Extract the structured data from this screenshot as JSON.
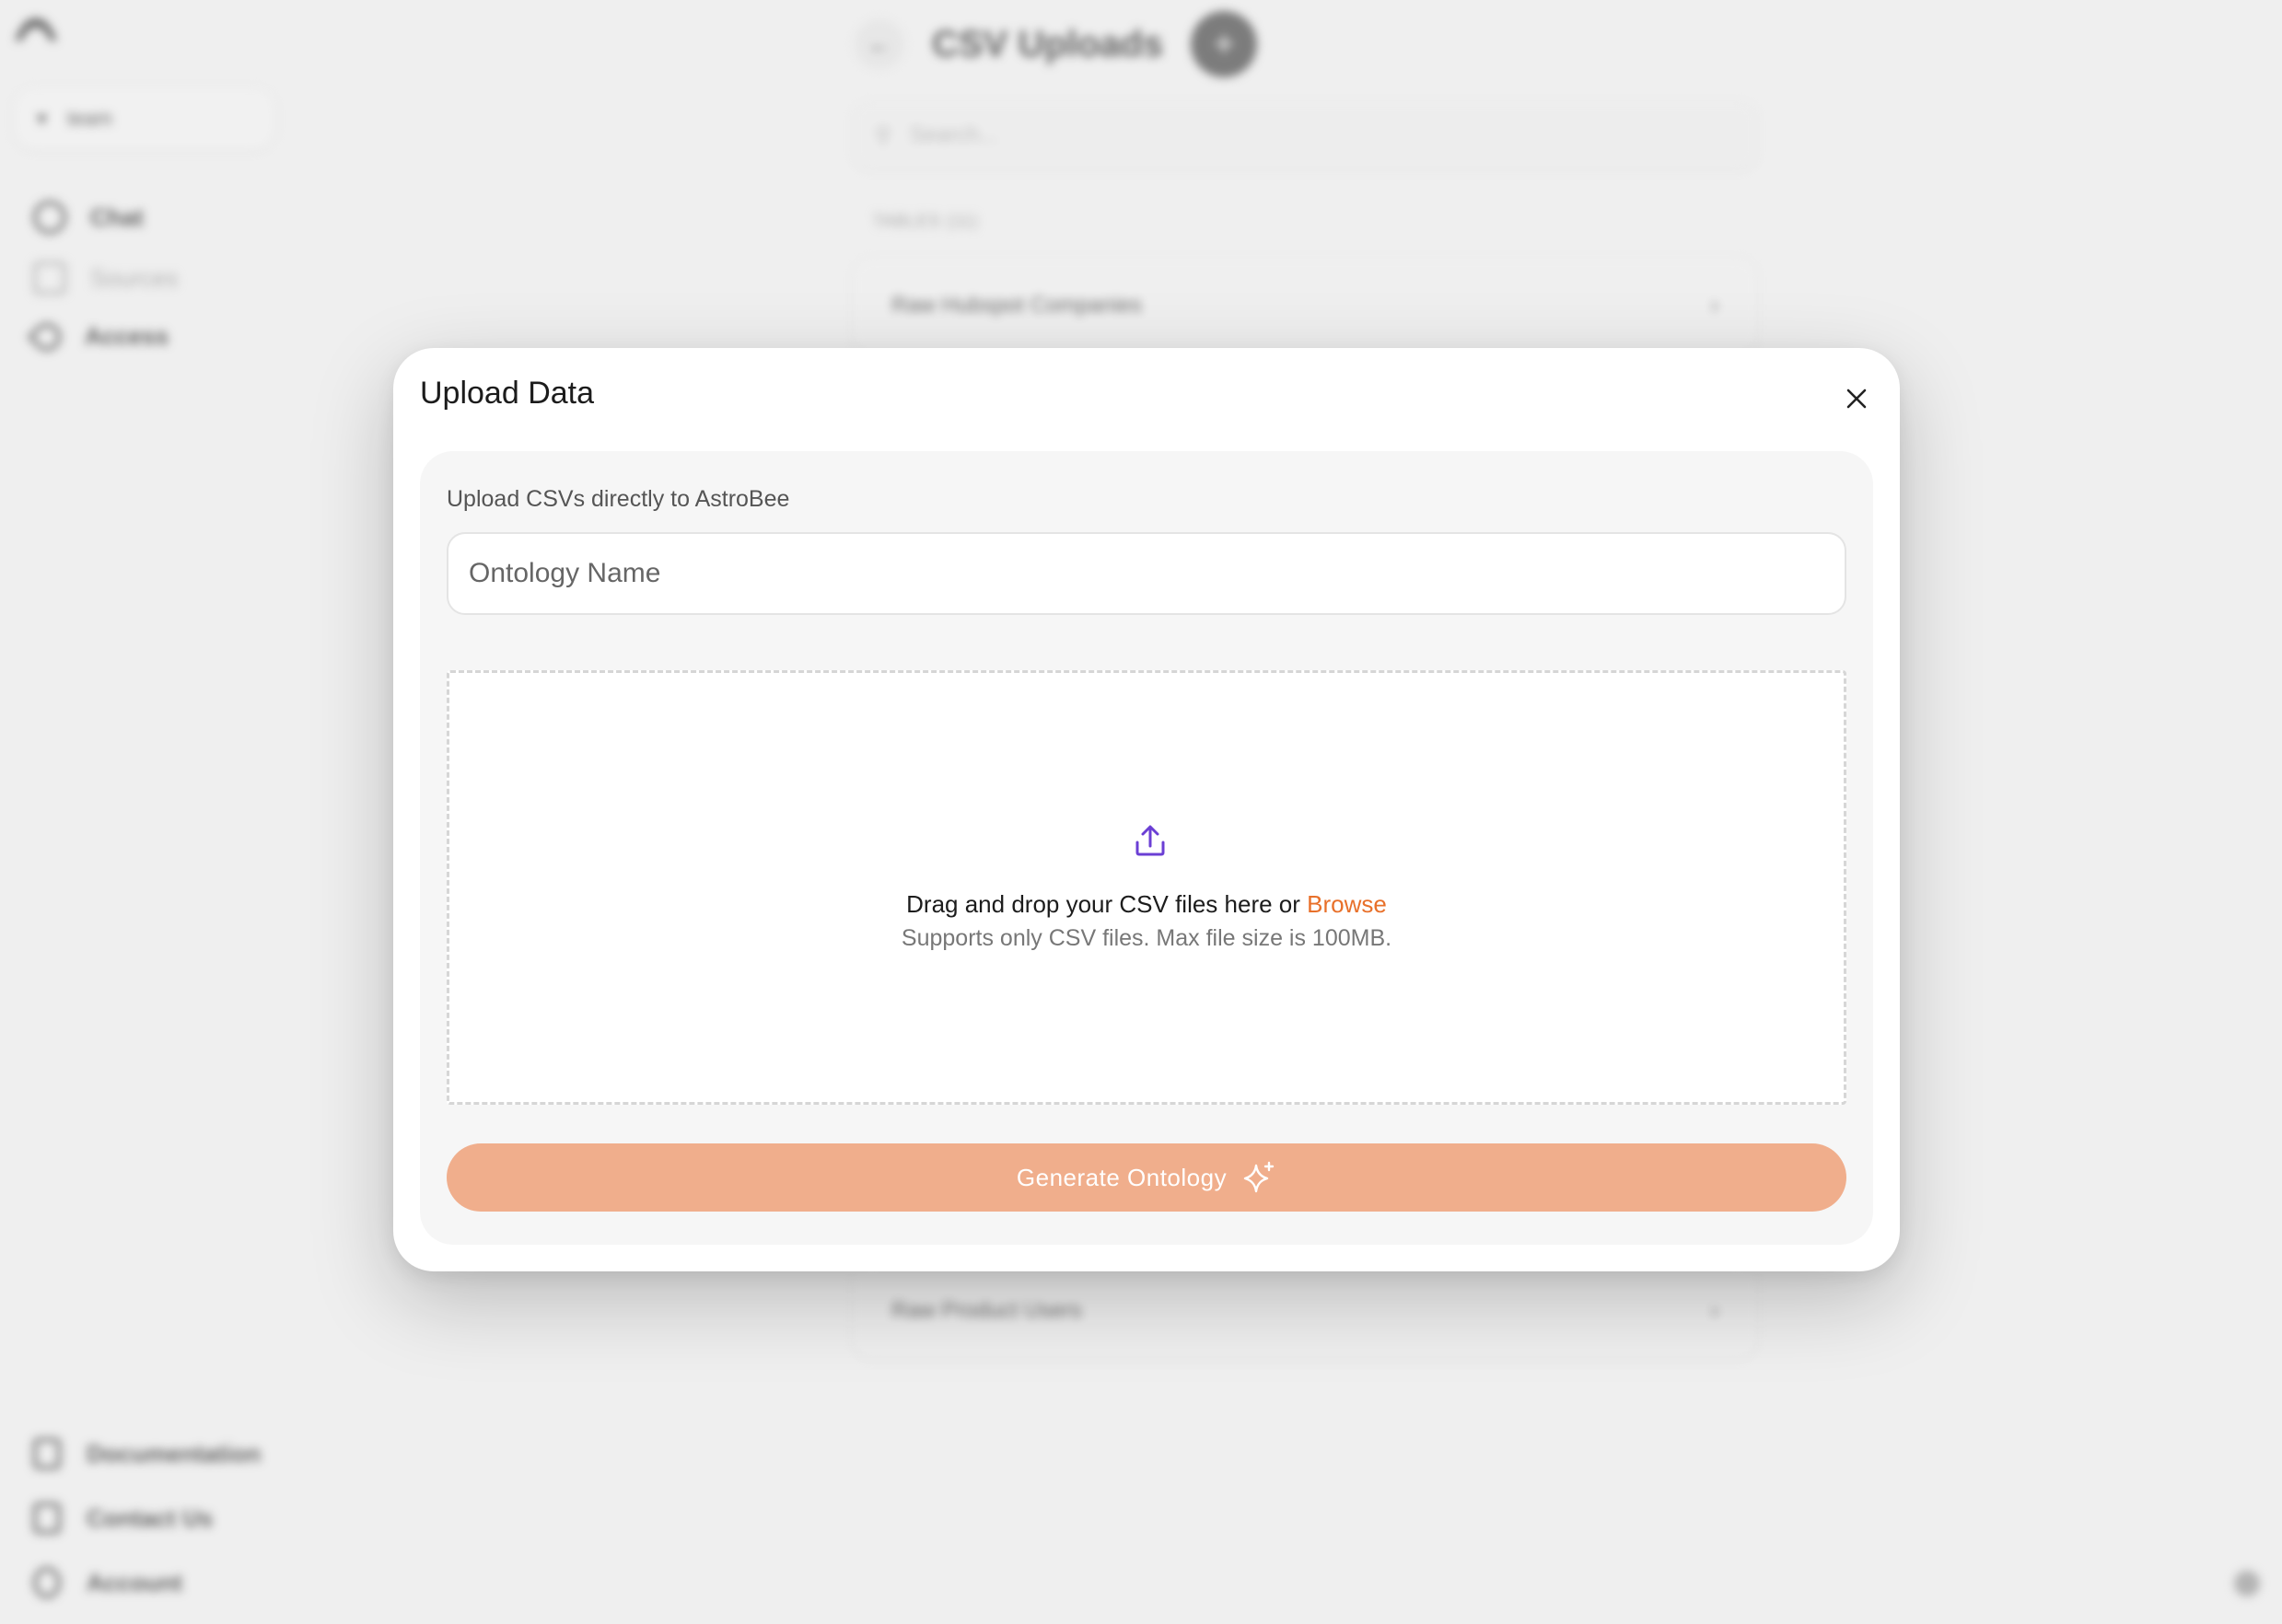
{
  "background": {
    "workspace_selector": "team",
    "nav": {
      "chat": "Chat",
      "sources": "Sources",
      "access": "Access"
    },
    "page_title": "CSV Uploads",
    "add_button": "+",
    "back_button": "←",
    "search_placeholder": "Search...",
    "tables_heading": "TABLES (11)",
    "rows": [
      "Raw Hubspot Companies",
      "Raw Product Users"
    ],
    "footer_nav": {
      "documentation": "Documentation",
      "contact": "Contact Us",
      "account": "Account"
    }
  },
  "modal": {
    "title": "Upload Data",
    "description": "Upload CSVs directly to AstroBee",
    "ontology_name_placeholder": "Ontology Name",
    "dropzone": {
      "text_prefix": "Drag and drop your CSV files here or ",
      "browse_label": "Browse",
      "subtext": "Supports only CSV files. Max file size is 100MB."
    },
    "generate_button_label": "Generate Ontology"
  },
  "colors": {
    "accent_orange": "#e8702a",
    "button_disabled": "#f0ae8c",
    "upload_icon": "#6b3fd4"
  }
}
